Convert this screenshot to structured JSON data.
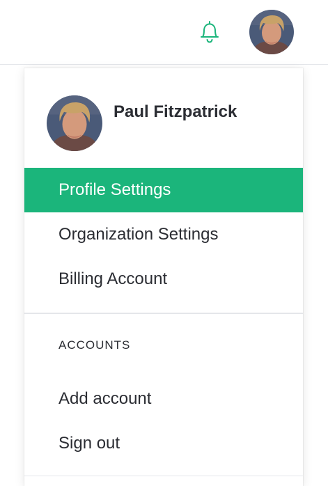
{
  "topbar": {
    "bell_icon": "bell-icon",
    "avatar_icon": "user-avatar-photo"
  },
  "user": {
    "name": "Paul Fitzpatrick",
    "avatar_icon": "user-avatar-photo"
  },
  "menu": {
    "items": [
      {
        "label": "Profile Settings",
        "active": true
      },
      {
        "label": "Organization Settings",
        "active": false
      },
      {
        "label": "Billing Account",
        "active": false
      }
    ]
  },
  "accounts": {
    "heading": "ACCOUNTS",
    "items": [
      {
        "label": "Add account"
      },
      {
        "label": "Sign out"
      }
    ]
  },
  "colors": {
    "accent": "#1bb57b",
    "text": "#2b2d33",
    "divider": "#e4e6ea"
  }
}
